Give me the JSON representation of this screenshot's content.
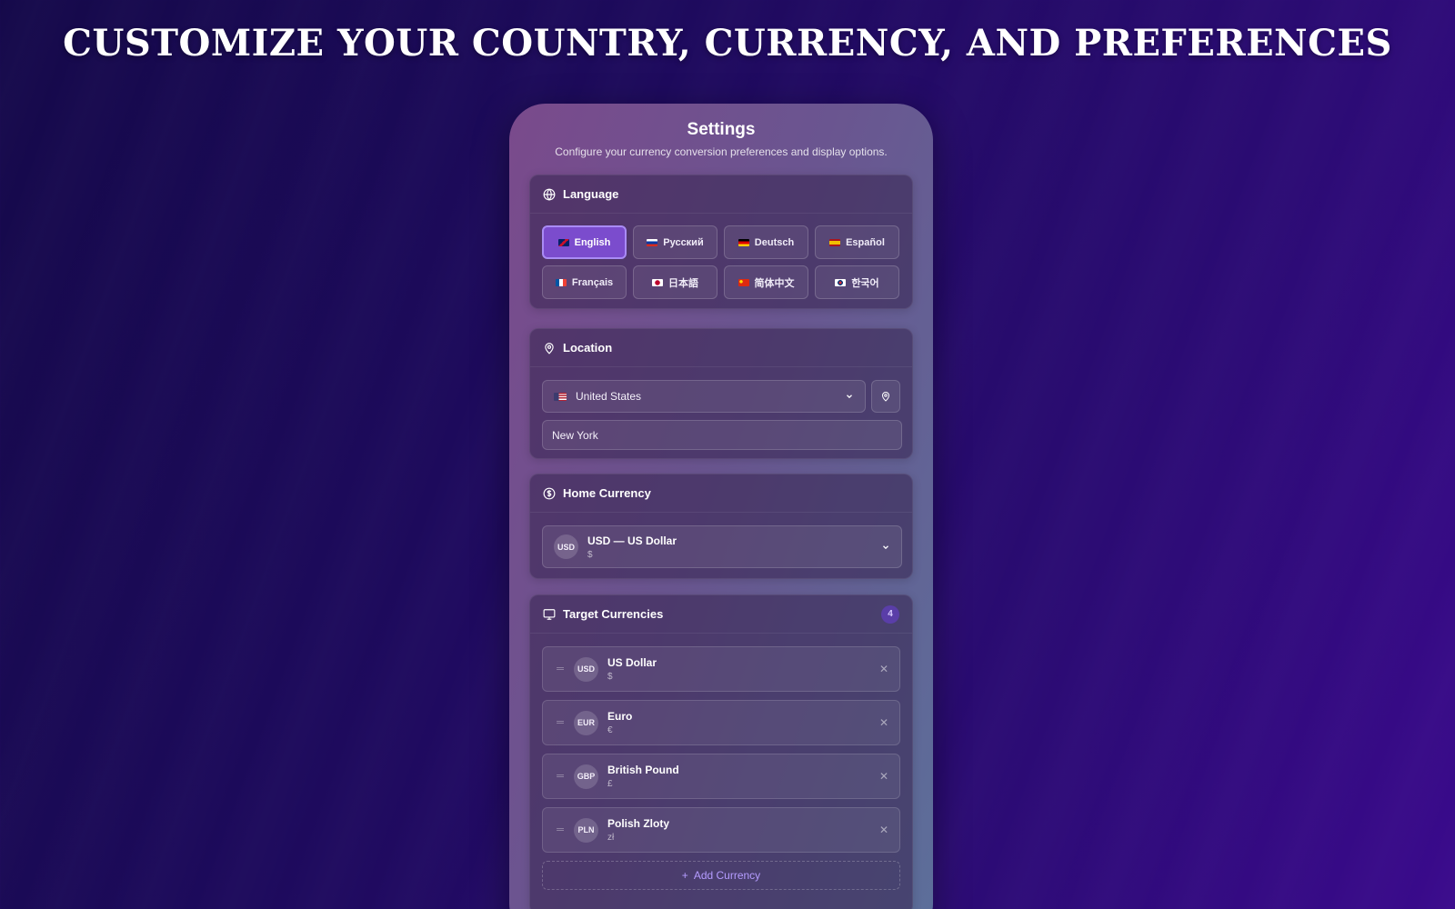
{
  "headline": "CUSTOMIZE YOUR COUNTRY, CURRENCY, AND PREFERENCES",
  "settings": {
    "title": "Settings",
    "subtitle": "Configure your currency conversion preferences and display options."
  },
  "language": {
    "heading": "Language",
    "icon": "globe-icon",
    "selected": "English",
    "options": [
      {
        "label": "English",
        "flag_colors": [
          "#012169",
          "#c8102e"
        ]
      },
      {
        "label": "Русский",
        "flag_colors": [
          "#ffffff",
          "#0039a6"
        ]
      },
      {
        "label": "Deutsch",
        "flag_colors": [
          "#000000",
          "#dd0000"
        ]
      },
      {
        "label": "Español",
        "flag_colors": [
          "#aa151b",
          "#f1bf00"
        ]
      },
      {
        "label": "Français",
        "flag_colors": [
          "#0055a4",
          "#ef4135"
        ]
      },
      {
        "label": "日本語",
        "flag_colors": [
          "#ffffff",
          "#bc002d"
        ]
      },
      {
        "label": "简体中文",
        "flag_colors": [
          "#de2910",
          "#ffde00"
        ]
      },
      {
        "label": "한국어",
        "flag_colors": [
          "#ffffff",
          "#003478"
        ]
      }
    ]
  },
  "location": {
    "heading": "Location",
    "icon": "map-pin-icon",
    "country": "United States",
    "city": "New York"
  },
  "home_currency": {
    "heading": "Home Currency",
    "icon": "dollar-circle-icon",
    "code": "USD",
    "label": "USD — US Dollar",
    "symbol": "$"
  },
  "target_currencies": {
    "heading": "Target Currencies",
    "icon": "monitor-icon",
    "count": "4",
    "items": [
      {
        "code": "USD",
        "name": "US Dollar",
        "symbol": "$"
      },
      {
        "code": "EUR",
        "name": "Euro",
        "symbol": "€"
      },
      {
        "code": "GBP",
        "name": "British Pound",
        "symbol": "£"
      },
      {
        "code": "PLN",
        "name": "Polish Zloty",
        "symbol": "zł"
      }
    ],
    "add_label": "Add Currency"
  },
  "colors": {
    "accent": "#7b4ccd",
    "accent_text": "#b59cff"
  }
}
